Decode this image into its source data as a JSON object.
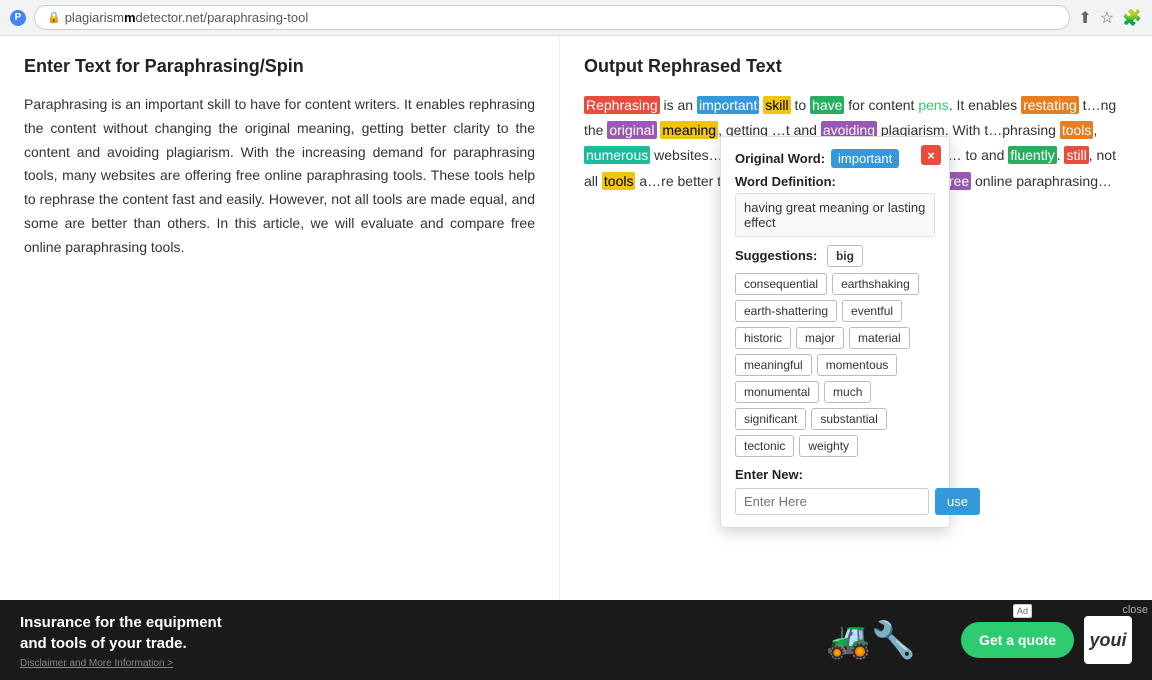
{
  "browser": {
    "url_prefix": "plagiarism",
    "url_bold": "m",
    "url_domain": "detector.net",
    "url_path": "/paraphrasing-tool",
    "full_url": "plagiarismdetector.net/paraphrasing-tool"
  },
  "left_panel": {
    "title": "Enter Text for Paraphrasing/Spin",
    "body": "Paraphrasing is an important skill to have for content writers. It enables rephrasing the content without changing the original meaning, getting better clarity to the content and avoiding plagiarism. With the increasing demand for paraphrasing tools, many websites are offering free online paraphrasing tools. These tools help to rephrase the content fast and easily. However, not all tools are made equal, and some are better than others. In this article, we will evaluate and compare free online paraphrasing tools."
  },
  "right_panel": {
    "title": "Output Rephrased Text"
  },
  "popup": {
    "original_word_label": "Original Word:",
    "original_word": "important",
    "definition_label": "Word Definition:",
    "definition": "having great meaning or lasting effect",
    "suggestions_label": "Suggestions:",
    "suggestions_first": "big",
    "suggestions": [
      "consequential",
      "earthshaking",
      "earth-shattering",
      "eventful",
      "historic",
      "major",
      "material",
      "meaningful",
      "momentous",
      "monumental",
      "much",
      "significant",
      "substantial",
      "tectonic",
      "weighty"
    ],
    "enter_new_label": "Enter New:",
    "enter_new_placeholder": "Enter Here",
    "use_button": "use",
    "close_button": "×"
  },
  "ad": {
    "main_text_line1": "Insurance for the equipment",
    "main_text_line2": "and tools of your trade.",
    "disclaimer": "Disclaimer and More Information >",
    "cta_button": "Get a quote",
    "brand": "youi",
    "close_label": "close"
  }
}
